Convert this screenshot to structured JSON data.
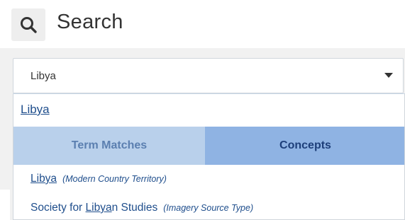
{
  "header": {
    "icon": "search-icon",
    "title": "Search"
  },
  "select": {
    "value": "Libya",
    "caret_icon": "caret-down-icon"
  },
  "dropdown": {
    "typed_text": "Libya",
    "tabs": [
      {
        "label": "Term Matches",
        "active": false
      },
      {
        "label": "Concepts",
        "active": true
      }
    ],
    "results": [
      {
        "prefix": "",
        "match": "Libya",
        "suffix": "",
        "type": "(Modern Country Territory)"
      },
      {
        "prefix": "Society for ",
        "match": "Libya",
        "suffix": "n Studies",
        "type": "(Imagery Source Type)"
      }
    ]
  },
  "colors": {
    "link": "#1f4e8c",
    "tab_inactive_bg": "#b9d0eb",
    "tab_active_bg": "#8fb3e3",
    "panel_bg": "#f1f1f1"
  }
}
